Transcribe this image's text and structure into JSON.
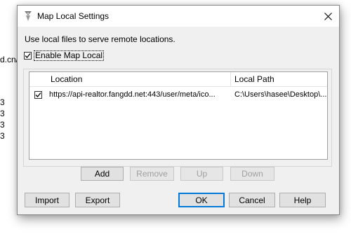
{
  "background": {
    "fragment_url": "d.cn/",
    "fragment_digits": [
      "3",
      "3",
      "3",
      "3"
    ]
  },
  "dialog": {
    "title": "Map Local Settings",
    "description": "Use local files to serve remote locations.",
    "enable_label": "Enable Map Local",
    "enable_checked": true,
    "table": {
      "columns": [
        "Location",
        "Local Path"
      ],
      "rows": [
        {
          "checked": true,
          "location": "https://api-realtor.fangdd.net:443/user/meta/ico...",
          "local_path": "C:\\Users\\hasee\\Desktop\\..."
        }
      ]
    },
    "list_buttons": {
      "add": "Add",
      "remove": "Remove",
      "up": "Up",
      "down": "Down"
    },
    "footer_buttons": {
      "import": "Import",
      "export": "Export",
      "ok": "OK",
      "cancel": "Cancel",
      "help": "Help"
    }
  },
  "colors": {
    "dialog_bg": "#f0f0f0",
    "titlebar_bg": "#ffffff",
    "accent": "#0078d7"
  }
}
